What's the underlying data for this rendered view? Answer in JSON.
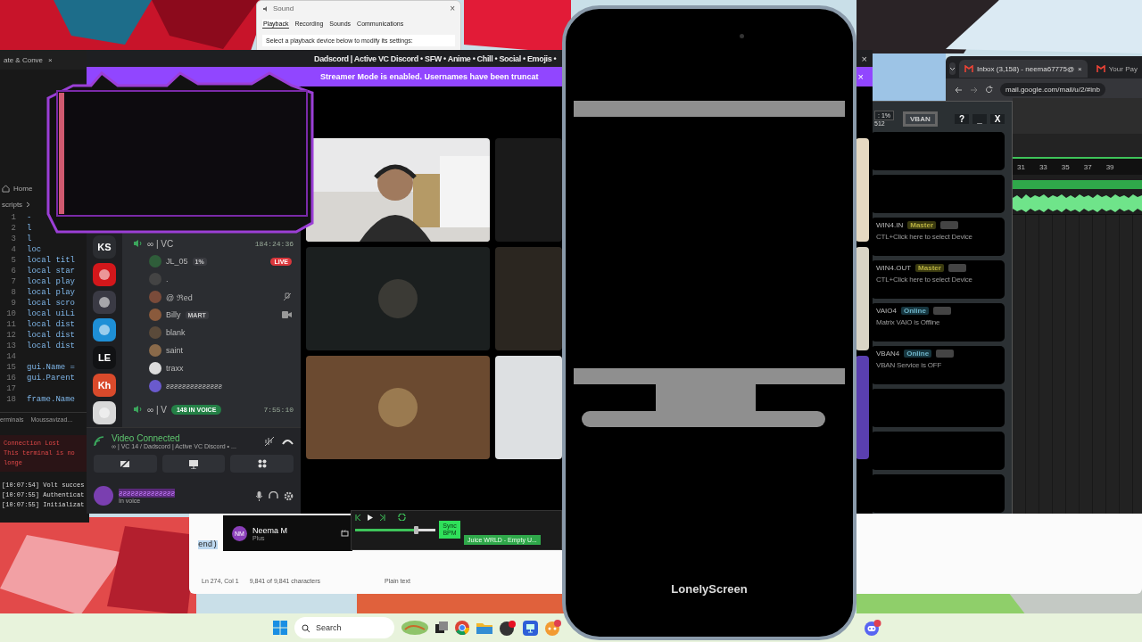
{
  "sound_window": {
    "title": "Sound",
    "close": "×",
    "tabs": [
      {
        "label": "Playback",
        "selected": true
      },
      {
        "label": "Recording",
        "selected": false
      },
      {
        "label": "Sounds",
        "selected": false
      },
      {
        "label": "Communications",
        "selected": false
      }
    ],
    "instruction": "Select a playback device below to modify its settings:"
  },
  "editor": {
    "tab": "ate & Conve",
    "tab_close": "×",
    "home": "Home",
    "breadcrumb": "scripts",
    "lines": [
      {
        "number": "1",
        "code": "-"
      },
      {
        "number": "2",
        "code": "l"
      },
      {
        "number": "3",
        "code": "l"
      },
      {
        "number": "4",
        "code": "loc"
      },
      {
        "number": "5",
        "code": "local titl"
      },
      {
        "number": "6",
        "code": "local star"
      },
      {
        "number": "7",
        "code": "local play"
      },
      {
        "number": "8",
        "code": "local play"
      },
      {
        "number": "9",
        "code": "local scro"
      },
      {
        "number": "10",
        "code": "local uiLi"
      },
      {
        "number": "11",
        "code": "local dist"
      },
      {
        "number": "12",
        "code": "local dist"
      },
      {
        "number": "13",
        "code": "local dist"
      },
      {
        "number": "14"
      },
      {
        "number": "15",
        "code": "gui.Name ="
      },
      {
        "number": "16",
        "code": "gui.Parent"
      },
      {
        "number": "17"
      },
      {
        "number": "18",
        "code": "frame.Name"
      }
    ],
    "panel_tabs": [
      "erminals",
      "Moussavizad..."
    ],
    "error_title": "Connection Lost",
    "error_text": "This terminal is no longe",
    "log": [
      "[10:07:54] Volt succes",
      "[10:07:55] Authenticat",
      "[10:07:55] Initializat"
    ]
  },
  "discord": {
    "title": "Dadscord | Active VC Discord • SFW • Anime • Chill • Social • Emojis •",
    "close": "×",
    "banner": "Streamer Mode is enabled. Usernames have been truncat",
    "banner_close": "×",
    "servers": [
      {
        "kind": "text",
        "label": "KS",
        "color": "#2b2d31"
      },
      {
        "kind": "logo",
        "color": "#d3171b"
      },
      {
        "kind": "logo",
        "color": "#3a3a44"
      },
      {
        "kind": "logo",
        "color": "#1e8fd6"
      },
      {
        "kind": "text",
        "label": "LE",
        "color": "#111214"
      },
      {
        "kind": "text",
        "label": "Kh",
        "color": "#d94a2b"
      },
      {
        "kind": "logo",
        "color": "#d8d8d8"
      }
    ],
    "channel": {
      "name": "∞ | VC",
      "timer": "184:24:36"
    },
    "members": [
      {
        "name": "JL_05",
        "tag": "1%",
        "live_badge": "LIVE",
        "kind": "plain"
      },
      {
        "name": ".",
        "kind": "plain"
      },
      {
        "name": "@ ℜed",
        "kind": "muted"
      },
      {
        "name": "Billy",
        "tag": "MART",
        "kind": "video"
      },
      {
        "name": "blank",
        "kind": "plain"
      },
      {
        "name": "saint",
        "kind": "plain"
      },
      {
        "name": "traxx",
        "kind": "plain"
      },
      {
        "name": "ƨƨƨƨƨƨƨƨƨƨƨƨƨƨ",
        "kind": "plain"
      }
    ],
    "channel2": {
      "name": "∞ | V",
      "voice_count": "148 IN VOICE",
      "timer": "7:55:10"
    },
    "voice_panel": {
      "status": "Video Connected",
      "detail": "∞ | VC 14 / Dadscord | Active VC Discord • ..."
    },
    "user": {
      "name": "ƨƨƨƨƨƨƨƨƨƨƨƨƨƨ",
      "status": "In voice"
    }
  },
  "phone": {
    "app_name": "LonelyScreen"
  },
  "chrome": {
    "tabs": [
      {
        "title": "Inbox (3,158) - neema67775@",
        "selected": true,
        "close": "×"
      },
      {
        "title": "Your Pay",
        "selected": false
      }
    ],
    "url": "mail.google.com/mail/u/2/#inb"
  },
  "voicemeeter": {
    "readout": ": 1%",
    "readout2": "512",
    "vban": "VBAN",
    "buttons": [
      "?",
      "_",
      "X"
    ],
    "strips": [
      {
        "name": "WIN4.IN",
        "state": "Master",
        "kind": "master",
        "on": false,
        "info": "CTL+Click here to select Device"
      },
      {
        "name": "WIN4.OUT",
        "state": "Master",
        "kind": "master",
        "on": false,
        "info": "CTL+Click here to select Device"
      },
      {
        "name": "VAIO4",
        "state": "Online",
        "kind": "online",
        "on": false,
        "info": "Matrix VAIO is Offline"
      },
      {
        "name": "VBAN4",
        "state": "Online",
        "kind": "online",
        "on": false,
        "info": "VBAN Service is OFF"
      }
    ]
  },
  "daw": {
    "ruler": [
      "31",
      "33",
      "35",
      "37",
      "39"
    ]
  },
  "profile": {
    "initials": "NM",
    "name": "Neema M",
    "plan": "Plus"
  },
  "dj": {
    "level": 0.76,
    "sync": "Sync BPM",
    "track": "Juice WRLD - Empty U..."
  },
  "notepad": {
    "text": "end)",
    "position": "Ln 274, Col 1",
    "count": "9,841 of 9,841 characters",
    "format": "Plain text"
  },
  "taskbar": {
    "search_placeholder": "Search"
  }
}
